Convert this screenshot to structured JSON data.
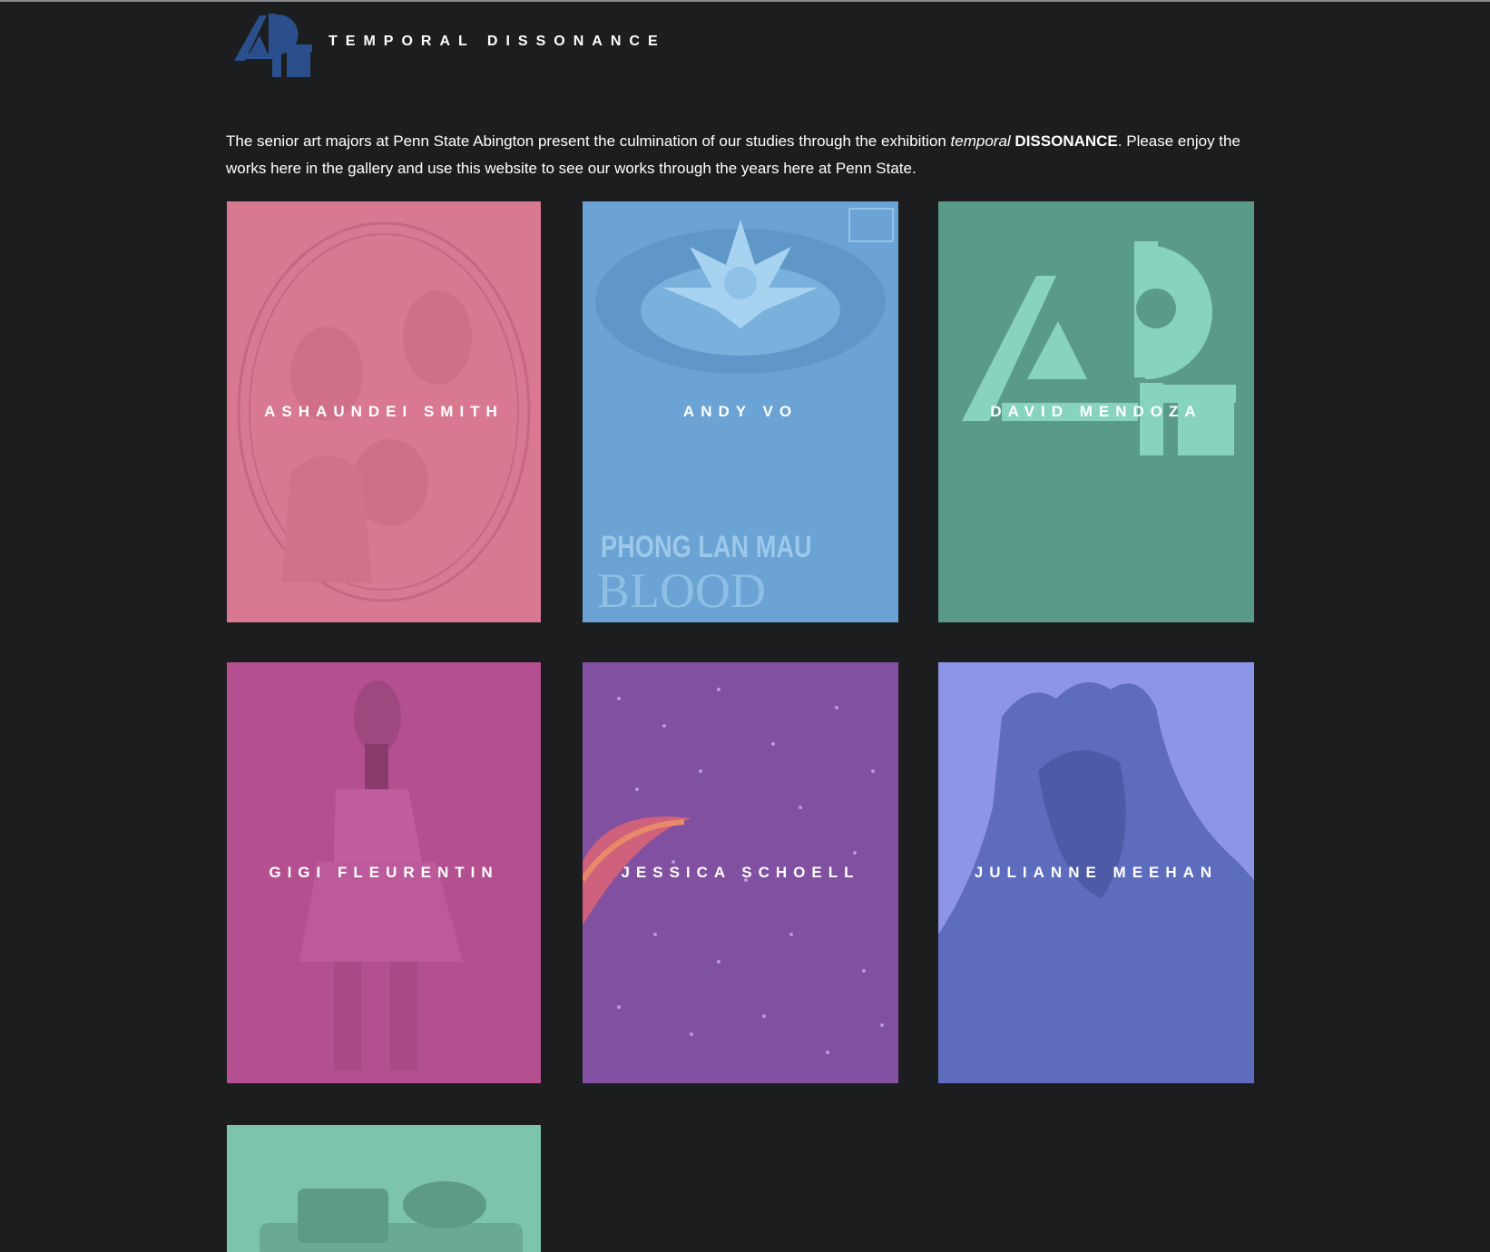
{
  "site": {
    "title": "TEMPORAL DISSONANCE",
    "logo_icon": "art-logo-icon"
  },
  "intro": {
    "before": "The senior art majors at Penn State Abington present the culmination of our studies through the exhibition ",
    "italic": "temporal",
    "bold": "DISSONANCE",
    "after": ". Please enjoy the works here in the gallery and use this website to see our works through the years here at Penn State."
  },
  "artists": [
    {
      "name": "ASHAUNDEI SMITH",
      "color": "#d97891"
    },
    {
      "name": "ANDY VO",
      "color": "#6aa3d4",
      "poster_lines": [
        "PHONG LAN MAU",
        "BLOOD LOTUS"
      ]
    },
    {
      "name": "DAVID MENDOZA",
      "color": "#5a9a89"
    },
    {
      "name": "GIGI FLEURENTIN",
      "color": "#b4508f"
    },
    {
      "name": "JESSICA SCHOELL",
      "color": "#8150a0"
    },
    {
      "name": "JULIANNE MEEHAN",
      "color": "#8d96e6"
    },
    {
      "name": "",
      "color": "#7dc4ac"
    }
  ]
}
